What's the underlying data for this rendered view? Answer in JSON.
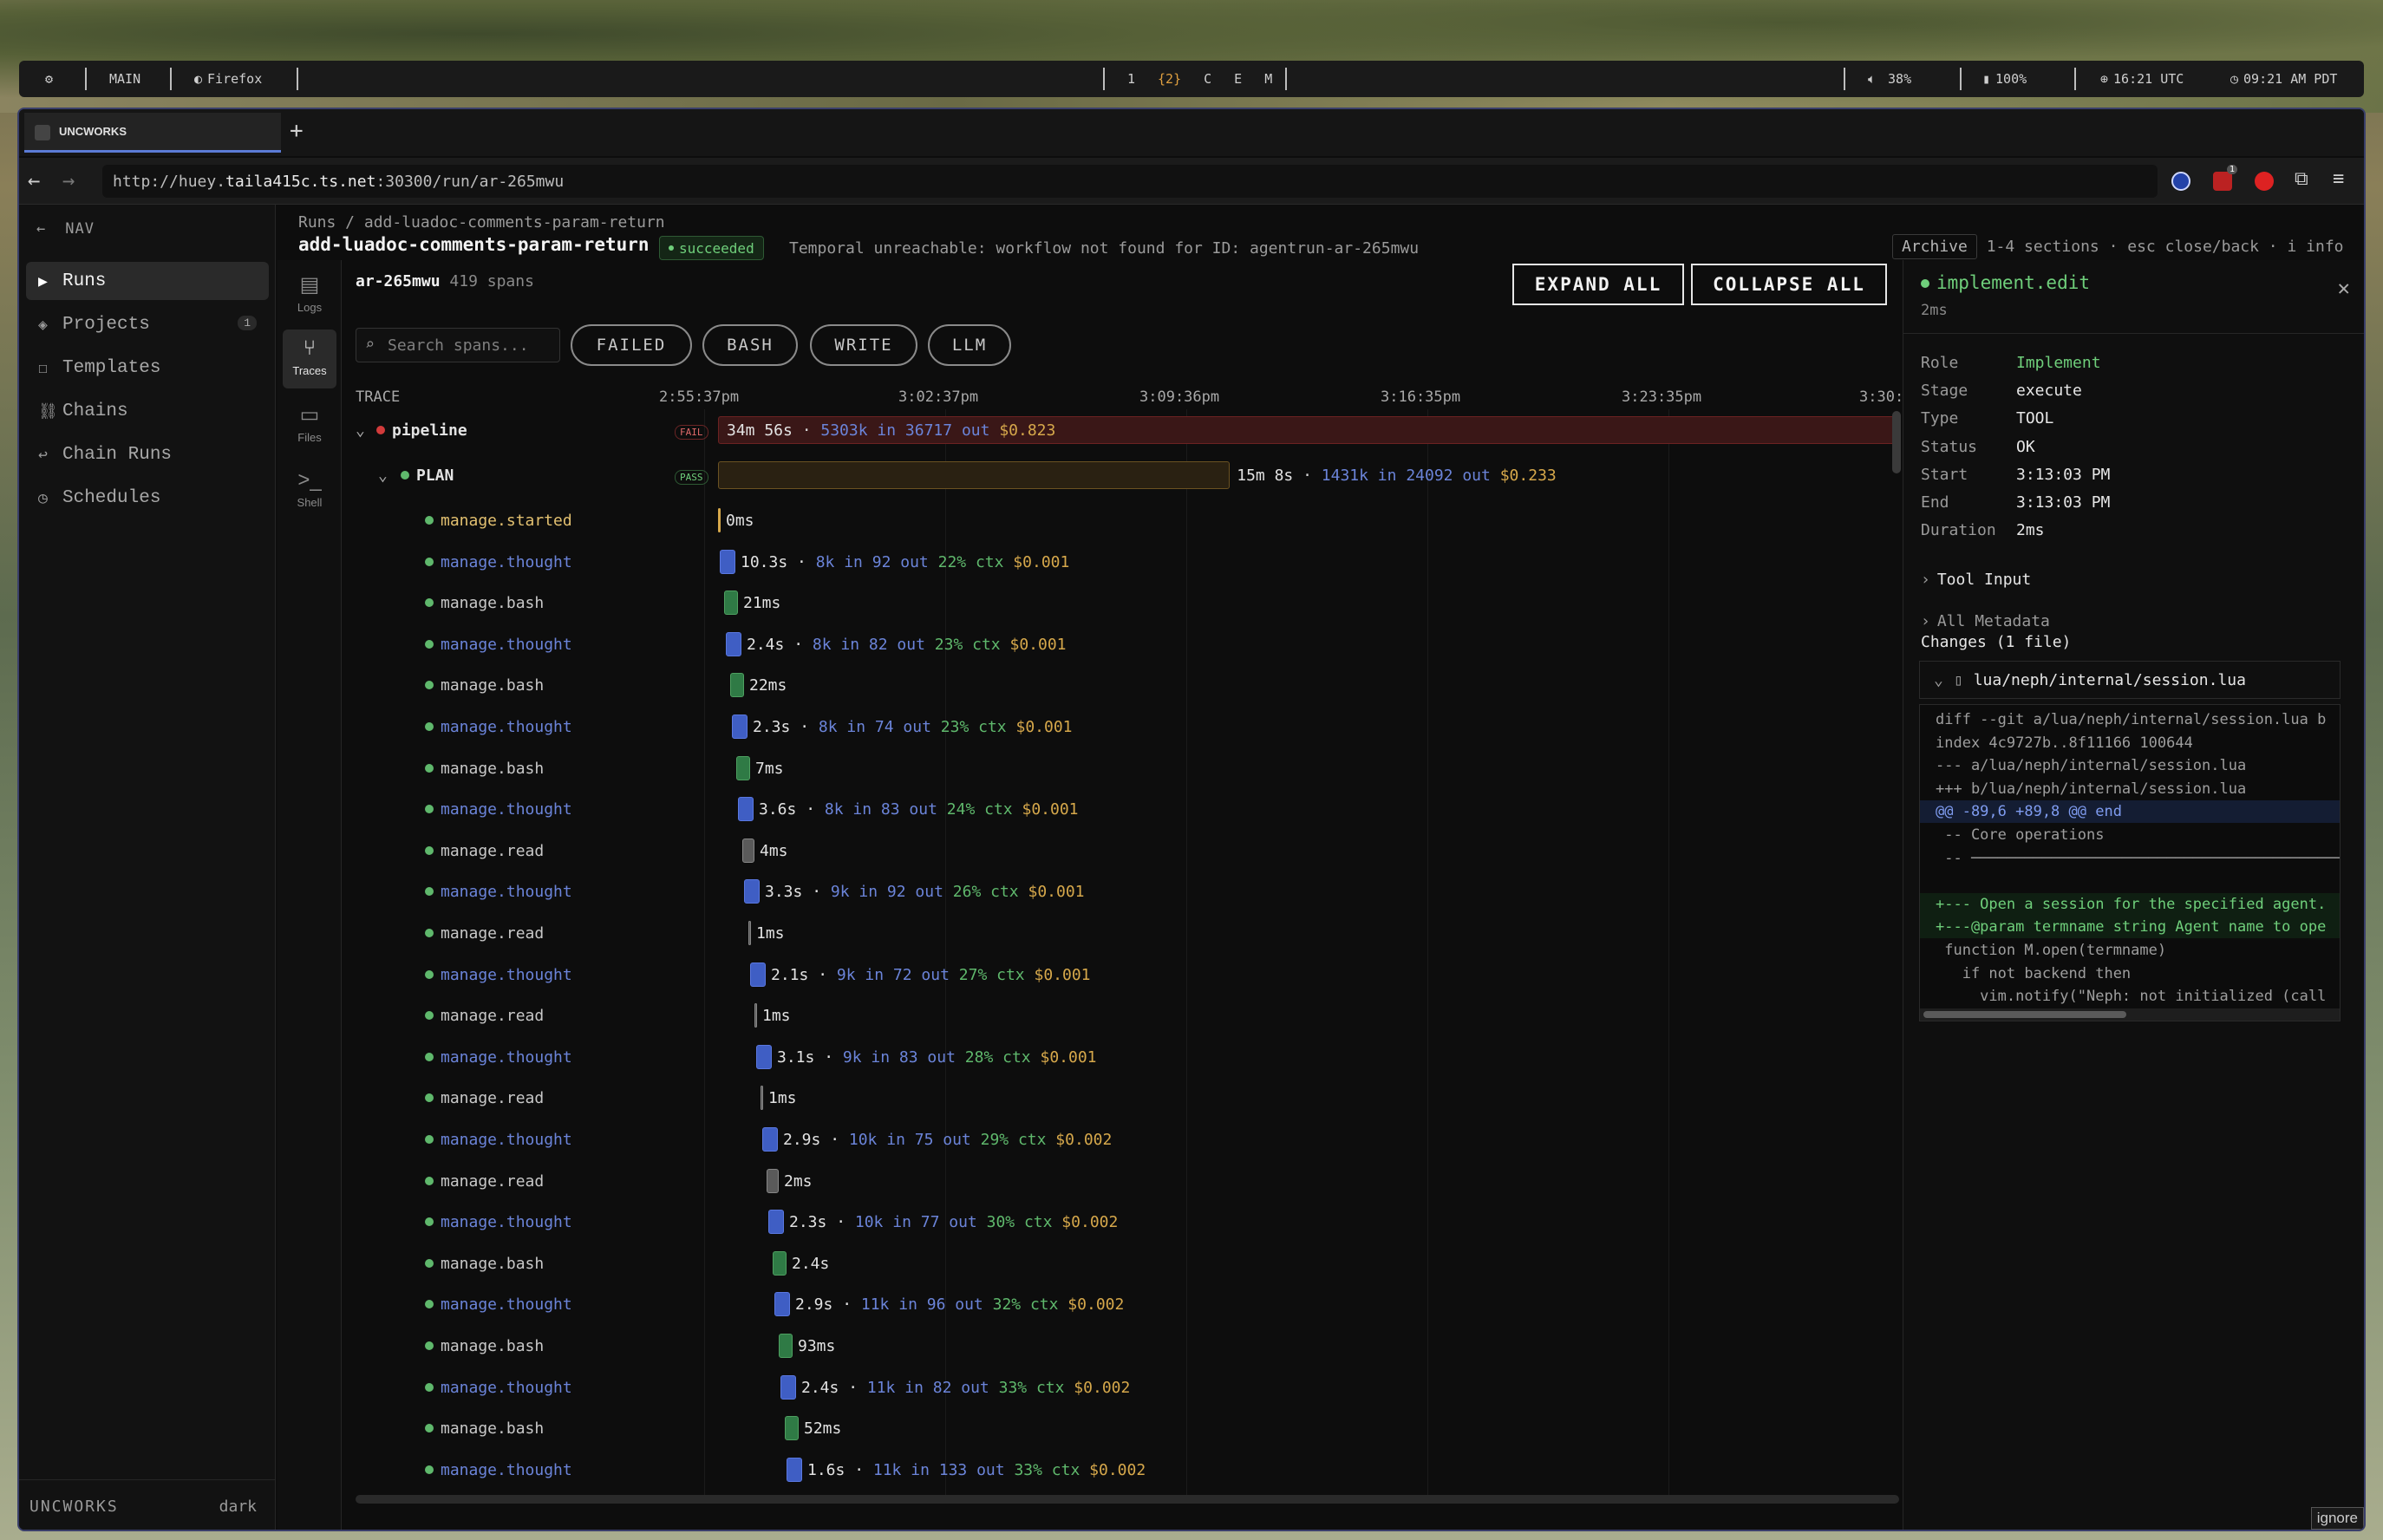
{
  "os_bar": {
    "workspace": "MAIN",
    "app": "Firefox",
    "desktops": [
      "1",
      "{2}",
      "C",
      "E",
      "M"
    ],
    "volume": "38%",
    "battery": "100%",
    "utc_time": "16:21 UTC",
    "local_time": "09:21 AM PDT"
  },
  "browser": {
    "tab_title": "UNCWORKS",
    "new_tab": "+",
    "url_prefix": "http://huey.",
    "url_host": "taila415c.ts.net",
    "url_rest": ":30300/run/ar-265mwu",
    "ext_badge": "1"
  },
  "sidebar": {
    "header": "NAV",
    "items": [
      {
        "label": "Runs",
        "icon": "play-icon"
      },
      {
        "label": "Projects",
        "icon": "diamond-icon",
        "count": "1"
      },
      {
        "label": "Templates",
        "icon": "square-icon"
      },
      {
        "label": "Chains",
        "icon": "chain-icon"
      },
      {
        "label": "Chain Runs",
        "icon": "return-arrow-icon"
      },
      {
        "label": "Schedules",
        "icon": "clock-icon"
      }
    ],
    "footer_brand": "UNCWORKS",
    "footer_theme": "dark"
  },
  "rail": [
    {
      "label": "Logs",
      "icon": "logs-icon"
    },
    {
      "label": "Traces",
      "icon": "traces-icon"
    },
    {
      "label": "Files",
      "icon": "folder-icon"
    },
    {
      "label": "Shell",
      "icon": "shell-icon"
    }
  ],
  "header": {
    "breadcrumb": "Runs / add-luadoc-comments-param-return",
    "title": "add-luadoc-comments-param-return",
    "status": "succeeded",
    "warning": "Temporal unreachable: workflow not found for ID: agentrun-ar-265mwu",
    "archive": "Archive",
    "hints": "1-4 sections · esc close/back · i info"
  },
  "trace": {
    "run_id": "ar-265mwu",
    "spans": "419 spans",
    "expand_all": "EXPAND ALL",
    "collapse_all": "COLLAPSE ALL",
    "search_placeholder": "Search spans...",
    "filters": [
      "FAILED",
      "BASH",
      "WRITE",
      "LLM"
    ],
    "column": "TRACE",
    "ticks": [
      "2:55:37pm",
      "3:02:37pm",
      "3:09:36pm",
      "3:16:35pm",
      "3:23:35pm",
      "3:30:"
    ],
    "pipeline": {
      "name": "pipeline",
      "status": "FAIL",
      "duration": "34m 56s",
      "in": "5303k in",
      "out": "36717 out",
      "cost": "$0.823",
      "fraction": 1.0
    },
    "plan": {
      "name": "PLAN",
      "status": "PASS",
      "duration": "15m 8s",
      "in": "1431k in",
      "out": "24092 out",
      "cost": "$0.233",
      "fraction": 0.434
    },
    "spans_list": [
      {
        "name": "manage.started",
        "kind": "start",
        "dur": "0ms"
      },
      {
        "name": "manage.thought",
        "kind": "thought",
        "dur": "10.3s",
        "tin": "8k in",
        "tout": "92 out",
        "ctx": "22% ctx",
        "cost": "$0.001"
      },
      {
        "name": "manage.bash",
        "kind": "bash",
        "dur": "21ms"
      },
      {
        "name": "manage.thought",
        "kind": "thought",
        "dur": "2.4s",
        "tin": "8k in",
        "tout": "82 out",
        "ctx": "23% ctx",
        "cost": "$0.001"
      },
      {
        "name": "manage.bash",
        "kind": "bash",
        "dur": "22ms"
      },
      {
        "name": "manage.thought",
        "kind": "thought",
        "dur": "2.3s",
        "tin": "8k in",
        "tout": "74 out",
        "ctx": "23% ctx",
        "cost": "$0.001"
      },
      {
        "name": "manage.bash",
        "kind": "bash",
        "dur": "7ms"
      },
      {
        "name": "manage.thought",
        "kind": "thought",
        "dur": "3.6s",
        "tin": "8k in",
        "tout": "83 out",
        "ctx": "24% ctx",
        "cost": "$0.001"
      },
      {
        "name": "manage.read",
        "kind": "read",
        "dur": "4ms"
      },
      {
        "name": "manage.thought",
        "kind": "thought",
        "dur": "3.3s",
        "tin": "9k in",
        "tout": "92 out",
        "ctx": "26% ctx",
        "cost": "$0.001"
      },
      {
        "name": "manage.read",
        "kind": "read",
        "dur": "1ms"
      },
      {
        "name": "manage.thought",
        "kind": "thought",
        "dur": "2.1s",
        "tin": "9k in",
        "tout": "72 out",
        "ctx": "27% ctx",
        "cost": "$0.001"
      },
      {
        "name": "manage.read",
        "kind": "read",
        "dur": "1ms"
      },
      {
        "name": "manage.thought",
        "kind": "thought",
        "dur": "3.1s",
        "tin": "9k in",
        "tout": "83 out",
        "ctx": "28% ctx",
        "cost": "$0.001"
      },
      {
        "name": "manage.read",
        "kind": "read",
        "dur": "1ms"
      },
      {
        "name": "manage.thought",
        "kind": "thought",
        "dur": "2.9s",
        "tin": "10k in",
        "tout": "75 out",
        "ctx": "29% ctx",
        "cost": "$0.002"
      },
      {
        "name": "manage.read",
        "kind": "read",
        "dur": "2ms"
      },
      {
        "name": "manage.thought",
        "kind": "thought",
        "dur": "2.3s",
        "tin": "10k in",
        "tout": "77 out",
        "ctx": "30% ctx",
        "cost": "$0.002"
      },
      {
        "name": "manage.bash",
        "kind": "bash",
        "dur": "2.4s"
      },
      {
        "name": "manage.thought",
        "kind": "thought",
        "dur": "2.9s",
        "tin": "11k in",
        "tout": "96 out",
        "ctx": "32% ctx",
        "cost": "$0.002"
      },
      {
        "name": "manage.bash",
        "kind": "bash",
        "dur": "93ms"
      },
      {
        "name": "manage.thought",
        "kind": "thought",
        "dur": "2.4s",
        "tin": "11k in",
        "tout": "82 out",
        "ctx": "33% ctx",
        "cost": "$0.002"
      },
      {
        "name": "manage.bash",
        "kind": "bash",
        "dur": "52ms"
      },
      {
        "name": "manage.thought",
        "kind": "thought",
        "dur": "1.6s",
        "tin": "11k in",
        "tout": "133 out",
        "ctx": "33% ctx",
        "cost": "$0.002"
      }
    ]
  },
  "detail": {
    "title": "implement.edit",
    "duration": "2ms",
    "fields": [
      {
        "k": "Role",
        "v": "Implement",
        "accent": true
      },
      {
        "k": "Stage",
        "v": "execute"
      },
      {
        "k": "Type",
        "v": "TOOL"
      },
      {
        "k": "Status",
        "v": "OK"
      },
      {
        "k": "Start",
        "v": "3:13:03 PM"
      },
      {
        "k": "End",
        "v": "3:13:03 PM"
      },
      {
        "k": "Duration",
        "v": "2ms"
      }
    ],
    "tool_input": "Tool Input",
    "all_metadata": "All Metadata",
    "changes": "Changes (1 file)",
    "file": "lua/neph/internal/session.lua",
    "diff": [
      {
        "t": "diff --git a/lua/neph/internal/session.lua b",
        "c": "meta"
      },
      {
        "t": "index 4c9727b..8f11166 100644",
        "c": "meta"
      },
      {
        "t": "--- a/lua/neph/internal/session.lua",
        "c": "meta"
      },
      {
        "t": "+++ b/lua/neph/internal/session.lua",
        "c": "meta"
      },
      {
        "t": "@@ -89,6 +89,8 @@ end",
        "c": "hunk"
      },
      {
        "t": " -- Core operations",
        "c": "ctx"
      },
      {
        "t": " -- ─────────────────────────────────────────────",
        "c": "ctx"
      },
      {
        "t": "",
        "c": "ctx"
      },
      {
        "t": "+--- Open a session for the specified agent.",
        "c": "add"
      },
      {
        "t": "+---@param termname string Agent name to ope",
        "c": "add"
      },
      {
        "t": " function M.open(termname)",
        "c": "ctx"
      },
      {
        "t": "   if not backend then",
        "c": "ctx"
      },
      {
        "t": "     vim.notify(\"Neph: not initialized (call",
        "c": "ctx"
      }
    ],
    "ignore": "ignore"
  },
  "colors": {
    "accent": "#6fcf7b",
    "thought": "#3f5ec4",
    "bash": "#2f7a45",
    "read": "#5a5a5a",
    "fail": "#d23b3b",
    "plan": "#8a6a1a"
  }
}
